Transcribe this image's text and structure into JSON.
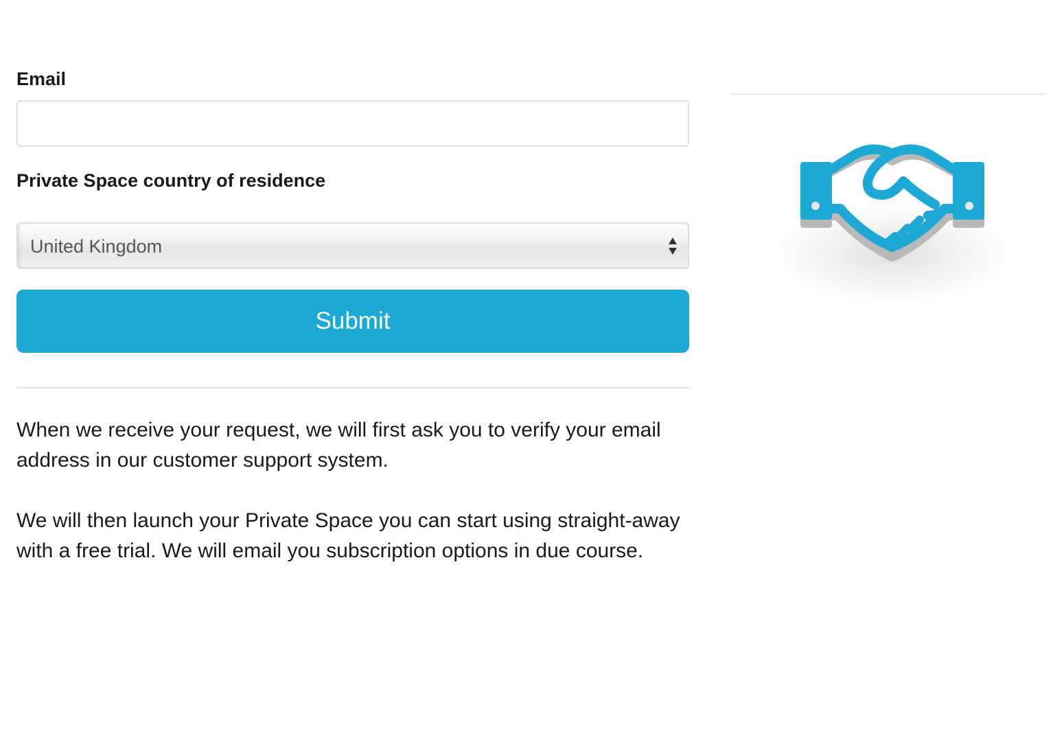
{
  "form": {
    "email_label": "Email",
    "email_value": "",
    "email_placeholder": "",
    "country_label": "Private Space country of residence",
    "country_selected": "United Kingdom",
    "submit_label": "Submit"
  },
  "info": {
    "paragraph_1": "When we receive your request, we will first ask you to verify your email address in our customer support system.",
    "paragraph_2": "We will then launch your Private Space you can start using straight-away with a free trial. We will email you subscription options in due course."
  },
  "side": {
    "icon": "handshake-icon"
  },
  "colors": {
    "accent": "#1ea8d6",
    "text": "#1a1a1a",
    "select_text": "#555555",
    "divider": "#e2e2e2"
  }
}
